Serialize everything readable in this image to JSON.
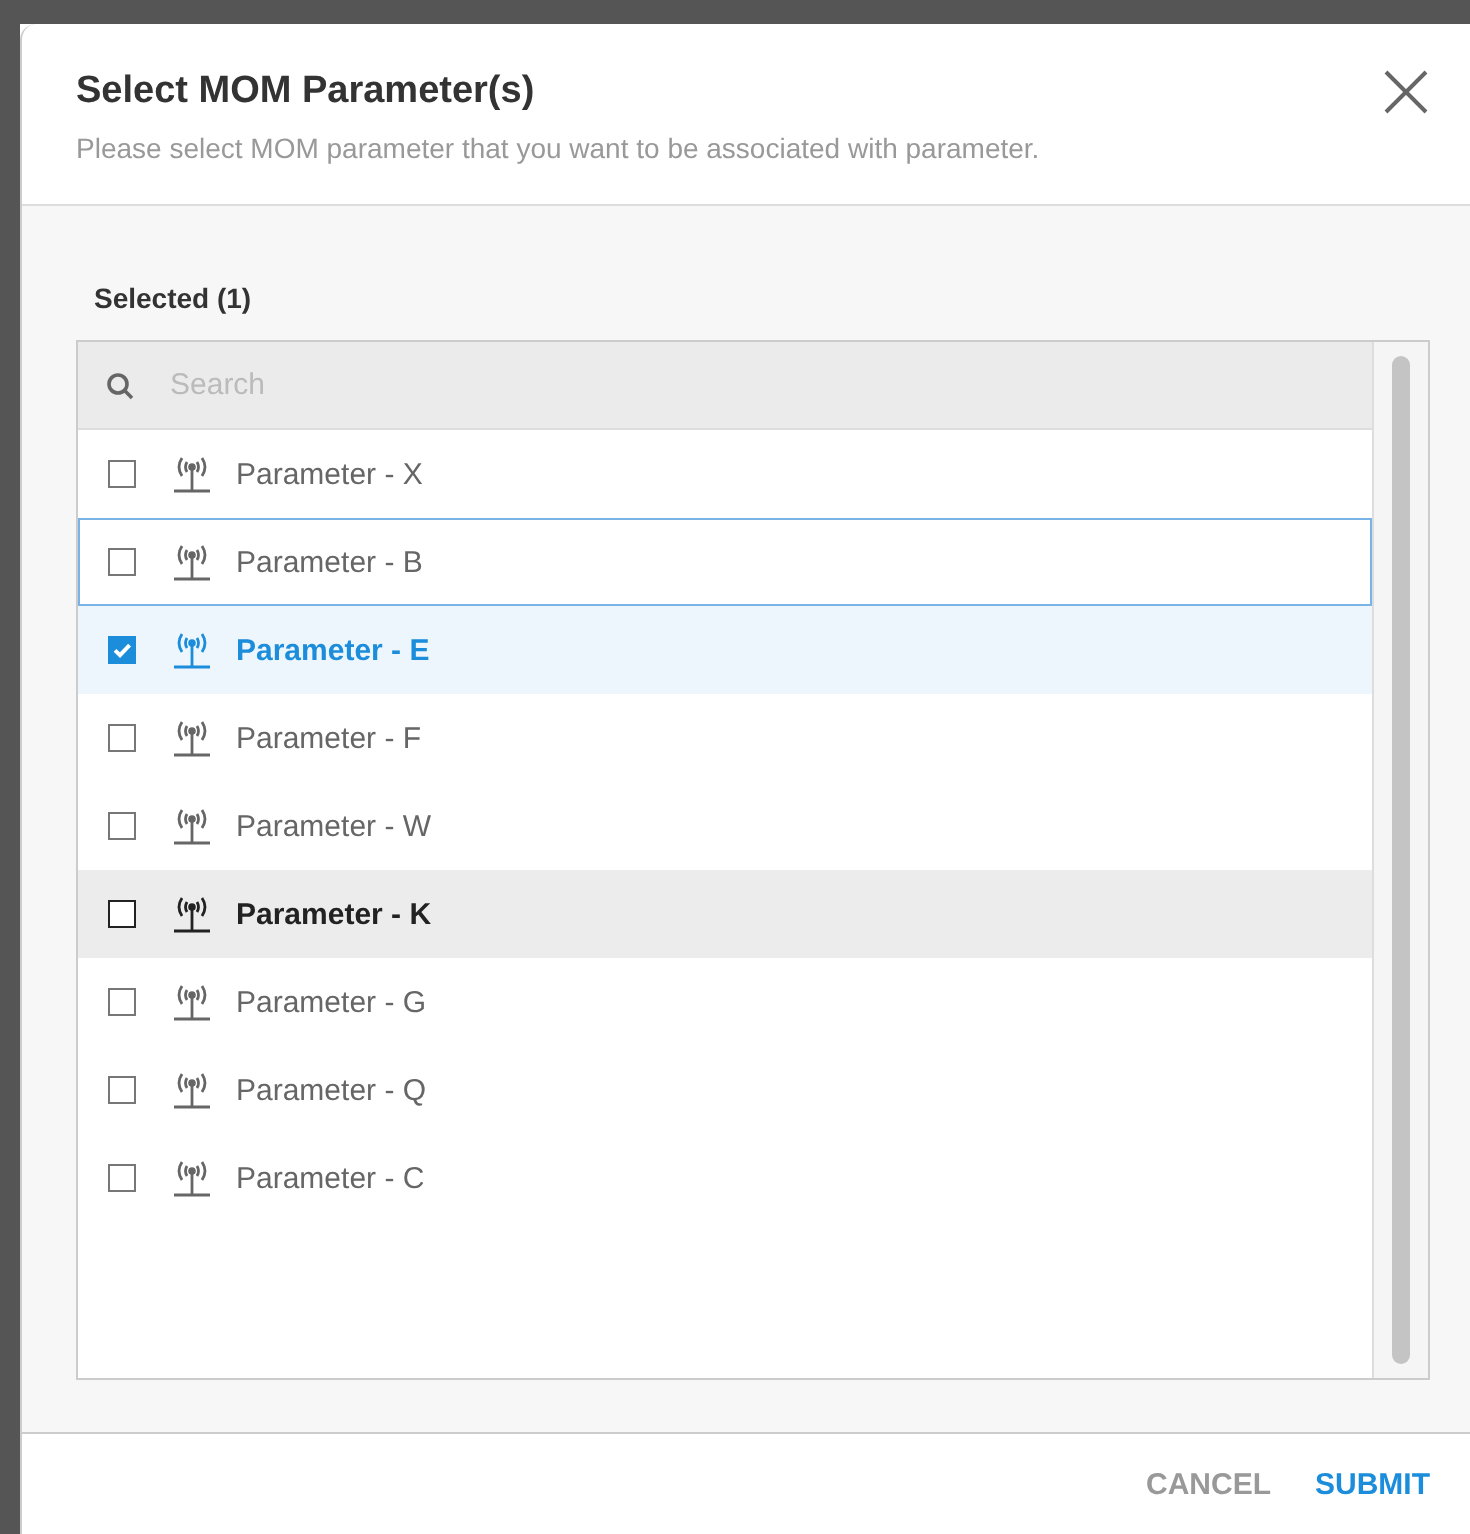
{
  "dialog": {
    "title": "Select MOM Parameter(s)",
    "subtitle": "Please select MOM parameter that you want to be associated with parameter."
  },
  "selected_label": "Selected (1)",
  "search": {
    "placeholder": "Search"
  },
  "items": [
    {
      "label": "Parameter - X",
      "checked": false,
      "focused": false,
      "hovered": false
    },
    {
      "label": "Parameter - B",
      "checked": false,
      "focused": true,
      "hovered": false
    },
    {
      "label": "Parameter - E",
      "checked": true,
      "focused": false,
      "hovered": false
    },
    {
      "label": "Parameter - F",
      "checked": false,
      "focused": false,
      "hovered": false
    },
    {
      "label": "Parameter - W",
      "checked": false,
      "focused": false,
      "hovered": false
    },
    {
      "label": "Parameter - K",
      "checked": false,
      "focused": false,
      "hovered": true
    },
    {
      "label": "Parameter - G",
      "checked": false,
      "focused": false,
      "hovered": false
    },
    {
      "label": "Parameter - Q",
      "checked": false,
      "focused": false,
      "hovered": false
    },
    {
      "label": "Parameter - C",
      "checked": false,
      "focused": false,
      "hovered": false
    }
  ],
  "buttons": [
    {
      "label": "CANCEL",
      "kind": "secondary"
    },
    {
      "label": "SUBMIT",
      "kind": "primary"
    }
  ]
}
